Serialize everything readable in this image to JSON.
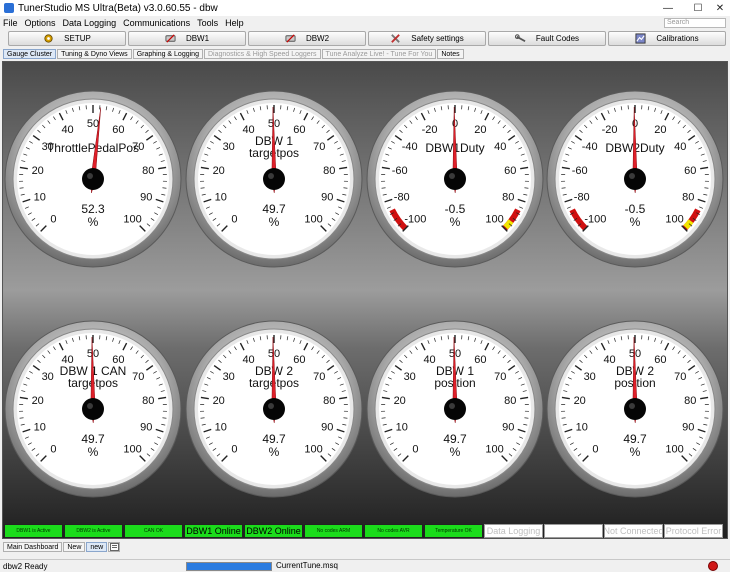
{
  "window": {
    "title": "TunerStudio MS Ultra(Beta) v3.0.60.55 - dbw",
    "controls": [
      "minimize-icon",
      "maximize-icon",
      "close-icon"
    ]
  },
  "menu": [
    "File",
    "Options",
    "Data Logging",
    "Communications",
    "Tools",
    "Help"
  ],
  "search": {
    "placeholder": "Search"
  },
  "toolbar": [
    {
      "label": "SETUP",
      "icon": "setup-icon"
    },
    {
      "label": "DBW1",
      "icon": "throttle-icon"
    },
    {
      "label": "DBW2",
      "icon": "throttle-icon"
    },
    {
      "label": "Safety settings",
      "icon": "tools-icon"
    },
    {
      "label": "Fault Codes",
      "icon": "wrench-icon"
    },
    {
      "label": "Calibrations",
      "icon": "calibration-icon"
    }
  ],
  "tabs": [
    {
      "label": "Gauge Cluster",
      "state": "active"
    },
    {
      "label": "Tuning & Dyno Views",
      "state": "normal"
    },
    {
      "label": "Graphing & Logging",
      "state": "normal"
    },
    {
      "label": "Diagnostics & High Speed Loggers",
      "state": "disabled"
    },
    {
      "label": "Tune Analyze Live! - Tune For You",
      "state": "disabled"
    },
    {
      "label": "Notes",
      "state": "normal"
    }
  ],
  "gauges": [
    {
      "title": [
        "ThrottlePedalPos"
      ],
      "value": "52.3",
      "units": "%",
      "min": 0,
      "max": 100,
      "ticks": [
        "0",
        "10",
        "20",
        "30",
        "40",
        "50",
        "60",
        "70",
        "80",
        "90",
        "100"
      ],
      "reading": 52.3,
      "redzone": false
    },
    {
      "title": [
        "DBW 1",
        "targetpos"
      ],
      "value": "49.7",
      "units": "%",
      "min": 0,
      "max": 100,
      "ticks": [
        "0",
        "10",
        "20",
        "30",
        "40",
        "50",
        "60",
        "70",
        "80",
        "90",
        "100"
      ],
      "reading": 49.7,
      "redzone": false
    },
    {
      "title": [
        "DBW1Duty"
      ],
      "value": "-0.5",
      "units": "%",
      "min": -100,
      "max": 100,
      "ticks": [
        "-100",
        "-80",
        "-60",
        "-40",
        "-20",
        "0",
        "20",
        "40",
        "60",
        "80",
        "100"
      ],
      "reading": -0.5,
      "redzone": true
    },
    {
      "title": [
        "DBW2Duty"
      ],
      "value": "-0.5",
      "units": "%",
      "min": -100,
      "max": 100,
      "ticks": [
        "-100",
        "-80",
        "-60",
        "-40",
        "-20",
        "0",
        "20",
        "40",
        "60",
        "80",
        "100"
      ],
      "reading": -0.5,
      "redzone": true
    },
    {
      "title": [
        "DBW 1 CAN",
        "targetpos"
      ],
      "value": "49.7",
      "units": "%",
      "min": 0,
      "max": 100,
      "ticks": [
        "0",
        "10",
        "20",
        "30",
        "40",
        "50",
        "60",
        "70",
        "80",
        "90",
        "100"
      ],
      "reading": 49.7,
      "redzone": false
    },
    {
      "title": [
        "DBW 2",
        "targetpos"
      ],
      "value": "49.7",
      "units": "%",
      "min": 0,
      "max": 100,
      "ticks": [
        "0",
        "10",
        "20",
        "30",
        "40",
        "50",
        "60",
        "70",
        "80",
        "90",
        "100"
      ],
      "reading": 49.7,
      "redzone": false
    },
    {
      "title": [
        "DBW 1",
        "position"
      ],
      "value": "49.7",
      "units": "%",
      "min": 0,
      "max": 100,
      "ticks": [
        "0",
        "10",
        "20",
        "30",
        "40",
        "50",
        "60",
        "70",
        "80",
        "90",
        "100"
      ],
      "reading": 49.7,
      "redzone": false
    },
    {
      "title": [
        "DBW 2",
        "position"
      ],
      "value": "49.7",
      "units": "%",
      "min": 0,
      "max": 100,
      "ticks": [
        "0",
        "10",
        "20",
        "30",
        "40",
        "50",
        "60",
        "70",
        "80",
        "90",
        "100"
      ],
      "reading": 49.7,
      "redzone": false
    }
  ],
  "indicators": [
    {
      "label": "DBW1 is Active",
      "state": "green",
      "size": "small"
    },
    {
      "label": "DBW2 is Active",
      "state": "green",
      "size": "small"
    },
    {
      "label": "CAN OK",
      "state": "green",
      "size": "small"
    },
    {
      "label": "DBW1 Online",
      "state": "green",
      "size": "big"
    },
    {
      "label": "DBW2 Online",
      "state": "green",
      "size": "big"
    },
    {
      "label": "No codes ARM",
      "state": "green",
      "size": "small"
    },
    {
      "label": "No codes AVR",
      "state": "green",
      "size": "small"
    },
    {
      "label": "Temperature OK",
      "state": "green",
      "size": "small"
    },
    {
      "label": "Data Logging",
      "state": "off",
      "size": "big"
    },
    {
      "label": "",
      "state": "off",
      "size": "big"
    },
    {
      "label": "Not Connected",
      "state": "off",
      "size": "big"
    },
    {
      "label": "Protocol Error",
      "state": "off",
      "size": "big"
    }
  ],
  "bottom_tabs": [
    {
      "label": "Main Dashboard",
      "state": "normal"
    },
    {
      "label": "New",
      "state": "normal"
    },
    {
      "label": "new",
      "state": "active"
    }
  ],
  "status": {
    "text": "dbw2 Ready",
    "progress": 1.0,
    "file": "CurrentTune.msq",
    "connection_icon": "disconnected-icon"
  },
  "colors": {
    "gauge_needle": "#e0202a",
    "indicator_green": "#1bdc1b",
    "redzone": "#d01010",
    "progress": "#2a7be0"
  }
}
